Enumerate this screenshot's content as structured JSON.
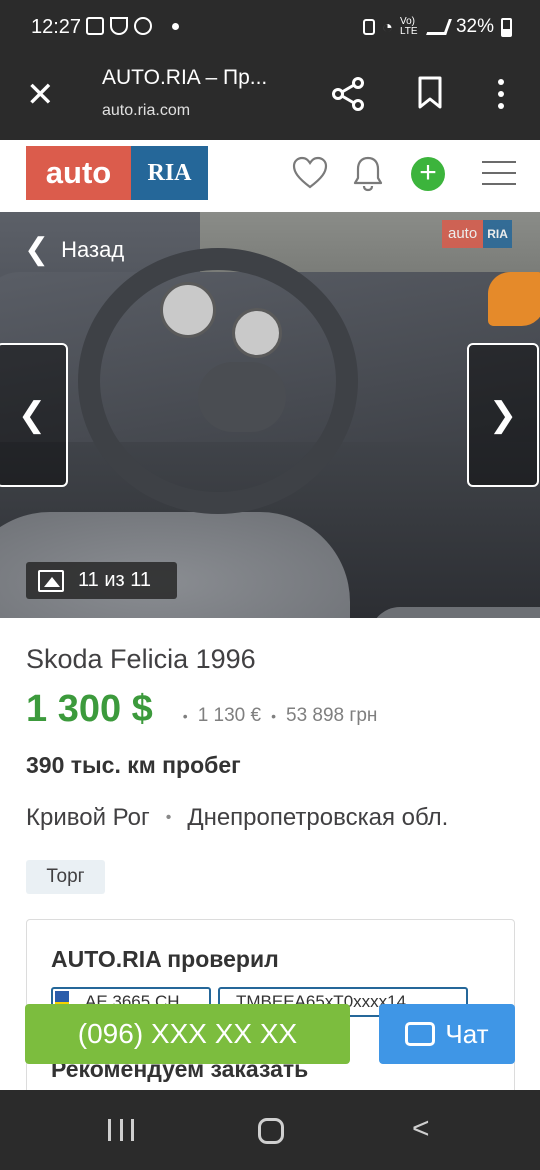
{
  "status_bar": {
    "time": "12:27",
    "network": "Vo) LTE",
    "battery": "32%"
  },
  "browser": {
    "title": "AUTO.RIA – Пр...",
    "url": "auto.ria.com",
    "close_icon": "✕"
  },
  "site_header": {
    "logo_auto": "auto",
    "logo_ria": "RIA",
    "plus_glyph": "+"
  },
  "gallery": {
    "back_label": "Назад",
    "back_chevron": "❮",
    "prev_glyph": "❮",
    "next_glyph": "❯",
    "counter": "11 из 11",
    "watermark_auto": "auto",
    "watermark_ria": "RIA"
  },
  "listing": {
    "title": "Skoda Felicia 1996",
    "price_usd": "1 300 $",
    "price_eur": "1 130 €",
    "price_uah": "53 898 грн",
    "separator": "•",
    "mileage": "390 тыс. км пробег",
    "city": "Кривой Рог",
    "region": "Днепропетровская обл.",
    "tag": "Торг"
  },
  "check_card": {
    "title": "AUTO.RIA проверил",
    "plate": "АЕ 3665 СН",
    "vin": "TMBEEA65xT0xxxx14",
    "recommend": "Рекомендуем заказать"
  },
  "actions": {
    "call_label": "(096) XXX XX XX",
    "chat_label": "Чат"
  },
  "colors": {
    "price_green": "#3c9a3c",
    "call_green": "#7cbd3e",
    "chat_blue": "#3f96e6",
    "logo_red": "#db5c4c",
    "logo_blue": "#256799"
  }
}
